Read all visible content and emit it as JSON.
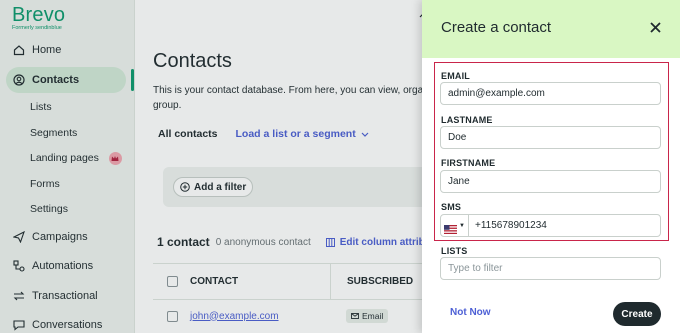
{
  "brand": {
    "name": "Brevo",
    "tagline": "Formerly sendinblue"
  },
  "sidebar": {
    "items": [
      {
        "label": "Home",
        "icon": "home-icon"
      },
      {
        "label": "Contacts",
        "icon": "contacts-icon",
        "active": true
      },
      {
        "label": "Lists"
      },
      {
        "label": "Segments"
      },
      {
        "label": "Landing pages",
        "badge_icon": "crown-icon"
      },
      {
        "label": "Forms"
      },
      {
        "label": "Settings"
      },
      {
        "label": "Campaigns",
        "icon": "send-icon"
      },
      {
        "label": "Automations",
        "icon": "automation-icon"
      },
      {
        "label": "Transactional",
        "icon": "transfer-icon"
      },
      {
        "label": "Conversations",
        "icon": "chat-icon"
      }
    ]
  },
  "main": {
    "title": "Contacts",
    "description_line1": "This is your contact database. From here, you can view, organi",
    "description_line2": "group.",
    "tabs": {
      "all": "All contacts",
      "load": "Load a list or a segment"
    },
    "add_filter": "Add a filter",
    "count": "1 contact",
    "anonymous": "0 anonymous contact",
    "edit_columns": "Edit column attribut",
    "table": {
      "headers": {
        "contact": "CONTACT",
        "subscribed": "SUBSCRIBED"
      },
      "rows": [
        {
          "email": "john@example.com",
          "channel": "Email"
        }
      ]
    }
  },
  "drawer": {
    "title": "Create a contact",
    "fields": {
      "email": {
        "label": "EMAIL",
        "value": "admin@example.com"
      },
      "lastname": {
        "label": "LASTNAME",
        "value": "Doe"
      },
      "firstname": {
        "label": "FIRSTNAME",
        "value": "Jane"
      },
      "sms": {
        "label": "SMS",
        "value": "+115678901234",
        "country_icon": "us-flag-icon"
      },
      "lists": {
        "label": "LISTS",
        "placeholder": "Type to filter"
      }
    },
    "not_now": "Not Now",
    "create": "Create"
  },
  "colors": {
    "brand_green": "#0b996e",
    "drawer_header": "#d9f7c3",
    "link_blue": "#4c5fd5",
    "highlight_red": "#c9254a",
    "dark_button": "#1f2a2e"
  }
}
